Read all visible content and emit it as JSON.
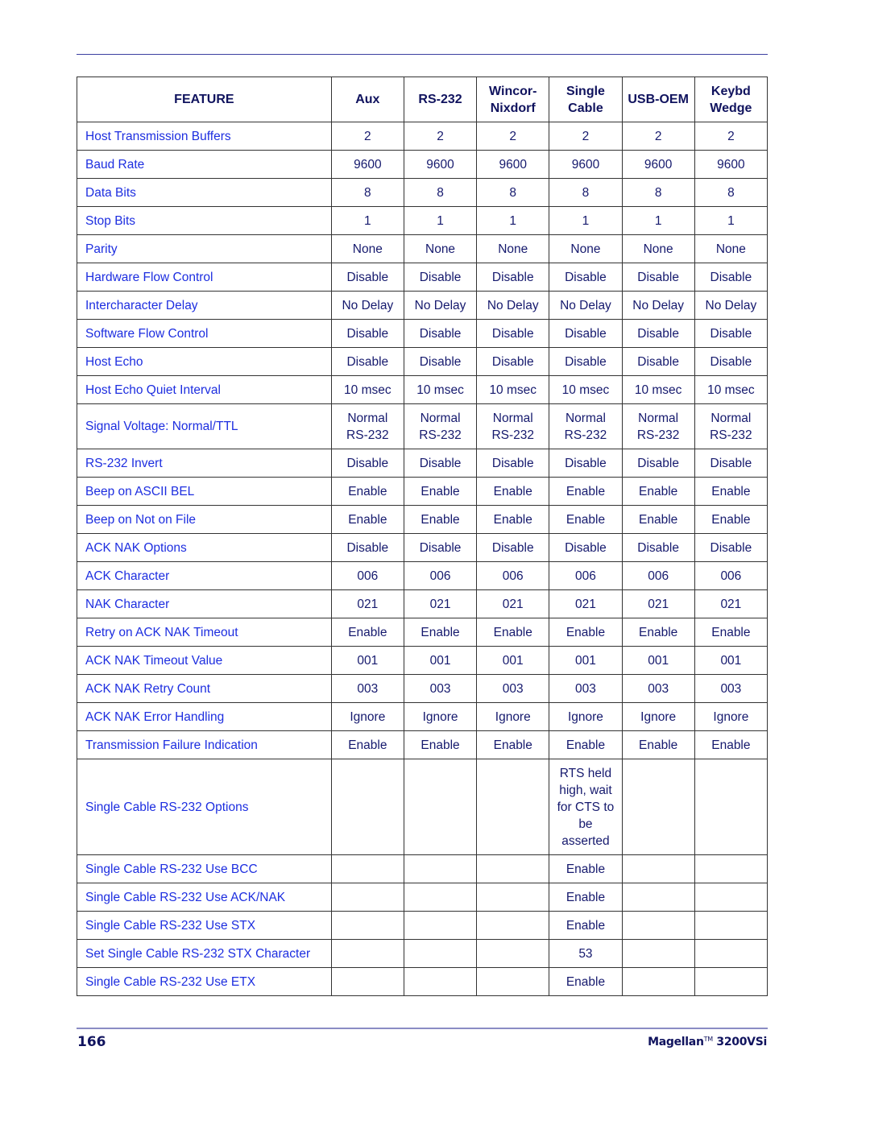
{
  "table": {
    "headers": [
      [
        "FEATURE"
      ],
      [
        "Aux"
      ],
      [
        "RS-232"
      ],
      [
        "Wincor-",
        "Nixdorf"
      ],
      [
        "Single",
        "Cable"
      ],
      [
        "USB-OEM"
      ],
      [
        "Keybd",
        "Wedge"
      ]
    ],
    "rows": [
      {
        "feature": "Host Transmission Buffers",
        "values": [
          [
            "2"
          ],
          [
            "2"
          ],
          [
            "2"
          ],
          [
            "2"
          ],
          [
            "2"
          ],
          [
            "2"
          ]
        ]
      },
      {
        "feature": "Baud Rate",
        "values": [
          [
            "9600"
          ],
          [
            "9600"
          ],
          [
            "9600"
          ],
          [
            "9600"
          ],
          [
            "9600"
          ],
          [
            "9600"
          ]
        ]
      },
      {
        "feature": "Data Bits",
        "values": [
          [
            "8"
          ],
          [
            "8"
          ],
          [
            "8"
          ],
          [
            "8"
          ],
          [
            "8"
          ],
          [
            "8"
          ]
        ]
      },
      {
        "feature": "Stop Bits",
        "values": [
          [
            "1"
          ],
          [
            "1"
          ],
          [
            "1"
          ],
          [
            "1"
          ],
          [
            "1"
          ],
          [
            "1"
          ]
        ]
      },
      {
        "feature": "Parity",
        "values": [
          [
            "None"
          ],
          [
            "None"
          ],
          [
            "None"
          ],
          [
            "None"
          ],
          [
            "None"
          ],
          [
            "None"
          ]
        ]
      },
      {
        "feature": "Hardware Flow Control",
        "values": [
          [
            "Disable"
          ],
          [
            "Disable"
          ],
          [
            "Disable"
          ],
          [
            "Disable"
          ],
          [
            "Disable"
          ],
          [
            "Disable"
          ]
        ]
      },
      {
        "feature": "Intercharacter Delay",
        "values": [
          [
            "No Delay"
          ],
          [
            "No Delay"
          ],
          [
            "No Delay"
          ],
          [
            "No Delay"
          ],
          [
            "No Delay"
          ],
          [
            "No Delay"
          ]
        ]
      },
      {
        "feature": "Software Flow Control",
        "values": [
          [
            "Disable"
          ],
          [
            "Disable"
          ],
          [
            "Disable"
          ],
          [
            "Disable"
          ],
          [
            "Disable"
          ],
          [
            "Disable"
          ]
        ]
      },
      {
        "feature": "Host Echo",
        "values": [
          [
            "Disable"
          ],
          [
            "Disable"
          ],
          [
            "Disable"
          ],
          [
            "Disable"
          ],
          [
            "Disable"
          ],
          [
            "Disable"
          ]
        ]
      },
      {
        "feature": "Host Echo Quiet Interval",
        "values": [
          [
            "10 msec"
          ],
          [
            "10 msec"
          ],
          [
            "10 msec"
          ],
          [
            "10 msec"
          ],
          [
            "10 msec"
          ],
          [
            "10 msec"
          ]
        ]
      },
      {
        "feature": "Signal Voltage: Normal/TTL",
        "values": [
          [
            "Normal",
            "RS-232"
          ],
          [
            "Normal",
            "RS-232"
          ],
          [
            "Normal",
            "RS-232"
          ],
          [
            "Normal",
            "RS-232"
          ],
          [
            "Normal",
            "RS-232"
          ],
          [
            "Normal",
            "RS-232"
          ]
        ]
      },
      {
        "feature": "RS-232 Invert",
        "values": [
          [
            "Disable"
          ],
          [
            "Disable"
          ],
          [
            "Disable"
          ],
          [
            "Disable"
          ],
          [
            "Disable"
          ],
          [
            "Disable"
          ]
        ]
      },
      {
        "feature": "Beep on ASCII BEL",
        "values": [
          [
            "Enable"
          ],
          [
            "Enable"
          ],
          [
            "Enable"
          ],
          [
            "Enable"
          ],
          [
            "Enable"
          ],
          [
            "Enable"
          ]
        ]
      },
      {
        "feature": "Beep on Not on File",
        "values": [
          [
            "Enable"
          ],
          [
            "Enable"
          ],
          [
            "Enable"
          ],
          [
            "Enable"
          ],
          [
            "Enable"
          ],
          [
            "Enable"
          ]
        ]
      },
      {
        "feature": "ACK NAK Options",
        "values": [
          [
            "Disable"
          ],
          [
            "Disable"
          ],
          [
            "Disable"
          ],
          [
            "Disable"
          ],
          [
            "Disable"
          ],
          [
            "Disable"
          ]
        ]
      },
      {
        "feature": "ACK Character",
        "values": [
          [
            "006"
          ],
          [
            "006"
          ],
          [
            "006"
          ],
          [
            "006"
          ],
          [
            "006"
          ],
          [
            "006"
          ]
        ]
      },
      {
        "feature": "NAK Character",
        "values": [
          [
            "021"
          ],
          [
            "021"
          ],
          [
            "021"
          ],
          [
            "021"
          ],
          [
            "021"
          ],
          [
            "021"
          ]
        ]
      },
      {
        "feature": "Retry on ACK NAK Timeout",
        "values": [
          [
            "Enable"
          ],
          [
            "Enable"
          ],
          [
            "Enable"
          ],
          [
            "Enable"
          ],
          [
            "Enable"
          ],
          [
            "Enable"
          ]
        ]
      },
      {
        "feature": "ACK NAK Timeout Value",
        "values": [
          [
            "001"
          ],
          [
            "001"
          ],
          [
            "001"
          ],
          [
            "001"
          ],
          [
            "001"
          ],
          [
            "001"
          ]
        ]
      },
      {
        "feature": "ACK NAK Retry Count",
        "values": [
          [
            "003"
          ],
          [
            "003"
          ],
          [
            "003"
          ],
          [
            "003"
          ],
          [
            "003"
          ],
          [
            "003"
          ]
        ]
      },
      {
        "feature": "ACK NAK Error Handling",
        "values": [
          [
            "Ignore"
          ],
          [
            "Ignore"
          ],
          [
            "Ignore"
          ],
          [
            "Ignore"
          ],
          [
            "Ignore"
          ],
          [
            "Ignore"
          ]
        ]
      },
      {
        "feature": "Transmission Failure Indication",
        "values": [
          [
            "Enable"
          ],
          [
            "Enable"
          ],
          [
            "Enable"
          ],
          [
            "Enable"
          ],
          [
            "Enable"
          ],
          [
            "Enable"
          ]
        ]
      },
      {
        "feature": "Single Cable RS-232 Options",
        "values": [
          [],
          [],
          [],
          [
            "RTS held",
            "high, wait",
            "for CTS to",
            "be",
            "asserted"
          ],
          [],
          []
        ]
      },
      {
        "feature": "Single Cable RS-232 Use BCC",
        "values": [
          [],
          [],
          [],
          [
            "Enable"
          ],
          [],
          []
        ]
      },
      {
        "feature": "Single Cable RS-232 Use ACK/NAK",
        "values": [
          [],
          [],
          [],
          [
            "Enable"
          ],
          [],
          []
        ]
      },
      {
        "feature": "Single Cable RS-232 Use STX",
        "values": [
          [],
          [],
          [],
          [
            "Enable"
          ],
          [],
          []
        ]
      },
      {
        "feature": "Set Single Cable RS-232 STX Character",
        "values": [
          [],
          [],
          [],
          [
            "53"
          ],
          [],
          []
        ]
      },
      {
        "feature": "Single Cable RS-232 Use ETX",
        "values": [
          [],
          [],
          [],
          [
            "Enable"
          ],
          [],
          []
        ]
      }
    ]
  },
  "footer": {
    "page_number": "166",
    "product_name": "Magellan",
    "trademark": "TM",
    "model": "3200VSi"
  }
}
